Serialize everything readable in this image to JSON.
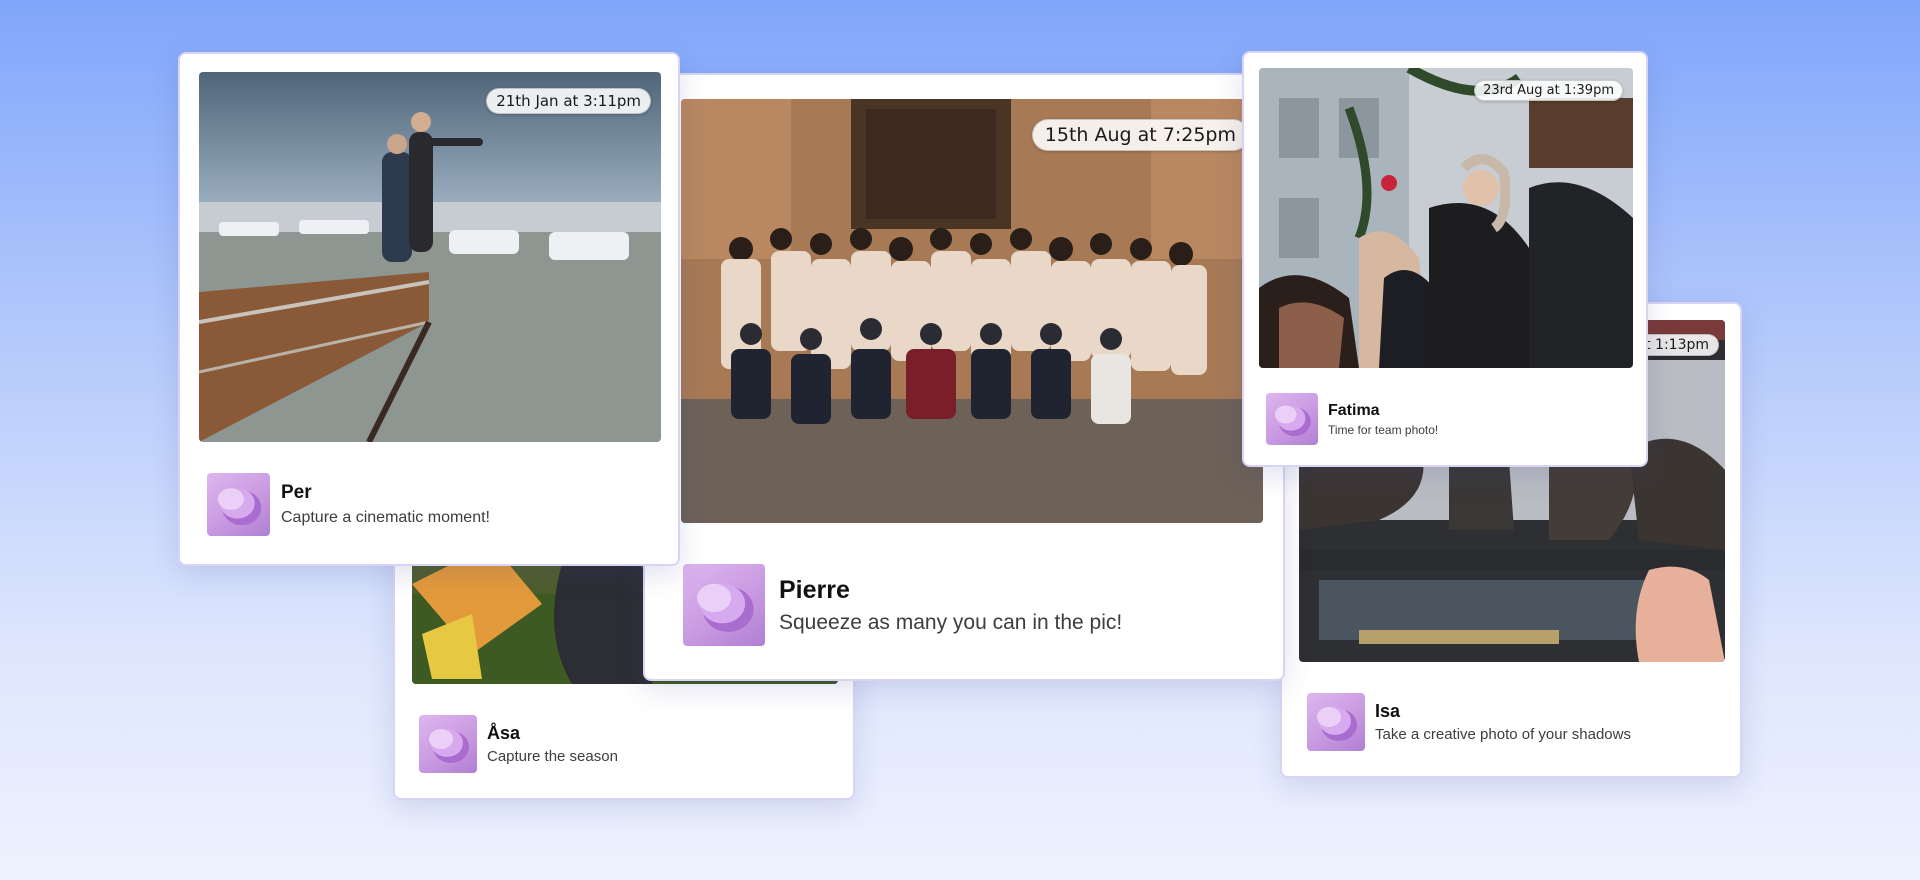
{
  "colors": {
    "background_top": "#80a6fb",
    "background_bottom": "#eef2fe",
    "card_border": "#d8d4f6",
    "icon_accent": "#c99ae1"
  },
  "cards": {
    "asa": {
      "user_name": "Åsa",
      "prompt": "Capture the season",
      "icon": "camera-app-icon"
    },
    "isa": {
      "user_name": "Isa",
      "prompt": "Take a creative photo of your shadows",
      "timestamp": "at 1:13pm",
      "icon": "camera-app-icon"
    },
    "pierre": {
      "user_name": "Pierre",
      "prompt": "Squeeze as many you can in the pic!",
      "timestamp": "15th Aug at 7:25pm",
      "icon": "camera-app-icon"
    },
    "per": {
      "user_name": "Per",
      "prompt": "Capture a cinematic moment!",
      "timestamp": "21th Jan at 3:11pm",
      "icon": "camera-app-icon"
    },
    "fatima": {
      "user_name": "Fatima",
      "prompt": "Time for team photo!",
      "timestamp": "23rd Aug at 1:39pm",
      "icon": "camera-app-icon"
    }
  }
}
